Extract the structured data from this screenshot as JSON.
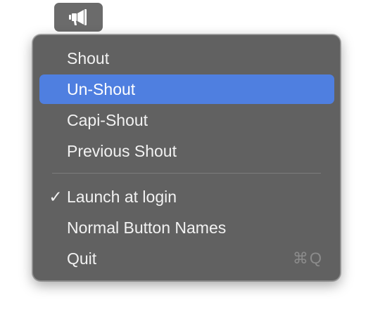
{
  "menubar": {
    "icon": "megaphone-icon"
  },
  "menu": {
    "items": [
      {
        "label": "Shout"
      },
      {
        "label": "Un-Shout"
      },
      {
        "label": "Capi-Shout"
      },
      {
        "label": "Previous Shout"
      }
    ],
    "options": [
      {
        "label": "Launch at login",
        "check": "✓"
      },
      {
        "label": "Normal Button Names"
      },
      {
        "label": "Quit",
        "shortcut": "⌘Q"
      }
    ],
    "selected_index": 1
  },
  "colors": {
    "menu_background": "#616161",
    "selection": "#4f7fe0",
    "text": "#f2f2f2",
    "shortcut_text": "#8c8c8c"
  }
}
